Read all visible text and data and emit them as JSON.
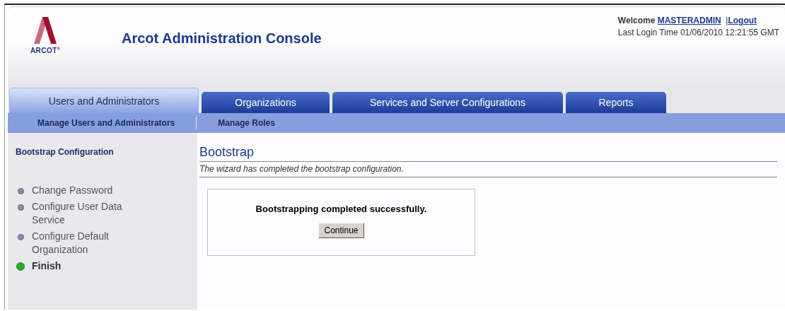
{
  "header": {
    "logo_text": "ARCOT$^{®}$",
    "title": "Arcot Administration Console",
    "welcome_label": "Welcome",
    "username": "MASTERADMIN",
    "separator": "|",
    "logout": "Logout",
    "last_login": "Last Login Time 01/06/2010 12:21:55 GMT"
  },
  "tabs": [
    {
      "label": "Users and Administrators",
      "selected": true
    },
    {
      "label": "Organizations",
      "selected": false
    },
    {
      "label": "Services and Server Configurations",
      "selected": false
    },
    {
      "label": "Reports",
      "selected": false
    }
  ],
  "subnav": [
    "Manage Users and Administrators",
    "Manage Roles"
  ],
  "sidebar": {
    "title": "Bootstrap Configuration",
    "steps": [
      {
        "label": "Change Password",
        "selected": false
      },
      {
        "label": "Configure User Data Service",
        "selected": false
      },
      {
        "label": "Configure Default Organization",
        "selected": false
      },
      {
        "label": "Finish",
        "selected": true
      }
    ]
  },
  "content": {
    "title": "Bootstrap",
    "description": "The wizard has completed the bootstrap configuration.",
    "message": "Bootstrapping completed successfully.",
    "button": "Continue"
  }
}
